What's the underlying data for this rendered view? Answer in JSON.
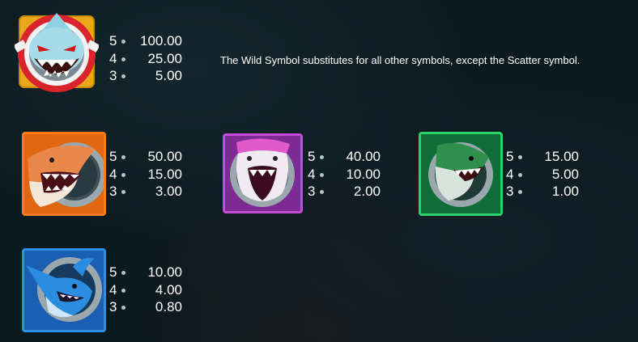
{
  "description": "The Wild Symbol substitutes for all other symbols, except the Scatter symbol.",
  "colors": {
    "background": "#0b1a1f",
    "orange": "#ff7a1a",
    "pink": "#c64bd6",
    "green": "#2bd16a",
    "blue": "#2f8fe6",
    "wild_ring": "#d9242b"
  },
  "symbols": [
    {
      "icon": "wild-shark-icon",
      "payouts": [
        {
          "count": "5",
          "value": "100.00"
        },
        {
          "count": "4",
          "value": "25.00"
        },
        {
          "count": "3",
          "value": "5.00"
        }
      ]
    },
    {
      "icon": "orange-shark-icon",
      "payouts": [
        {
          "count": "5",
          "value": "50.00"
        },
        {
          "count": "4",
          "value": "15.00"
        },
        {
          "count": "3",
          "value": "3.00"
        }
      ]
    },
    {
      "icon": "pink-shark-icon",
      "payouts": [
        {
          "count": "5",
          "value": "40.00"
        },
        {
          "count": "4",
          "value": "10.00"
        },
        {
          "count": "3",
          "value": "2.00"
        }
      ]
    },
    {
      "icon": "green-shark-icon",
      "payouts": [
        {
          "count": "5",
          "value": "15.00"
        },
        {
          "count": "4",
          "value": "5.00"
        },
        {
          "count": "3",
          "value": "1.00"
        }
      ]
    },
    {
      "icon": "blue-swordfish-icon",
      "payouts": [
        {
          "count": "5",
          "value": "10.00"
        },
        {
          "count": "4",
          "value": "4.00"
        },
        {
          "count": "3",
          "value": "0.80"
        }
      ]
    }
  ]
}
